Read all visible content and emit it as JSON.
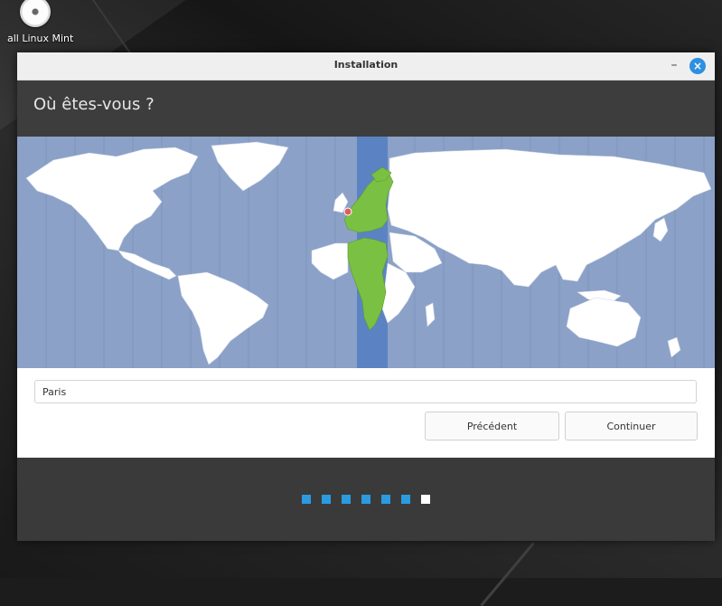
{
  "desktop": {
    "icon_label": "all Linux Mint",
    "icon_name": "disc-icon"
  },
  "window": {
    "title": "Installation",
    "minimize_label": "–",
    "close_label": "×"
  },
  "page": {
    "heading": "Où êtes-vous ?"
  },
  "map": {
    "selected_city": "Paris",
    "highlight_color": "#7ac143",
    "ocean_color": "#8ba1c7",
    "timezone_band_color": "#5b83c3",
    "marker_color": "#e05d5d"
  },
  "timezone_field": {
    "value": "Paris"
  },
  "buttons": {
    "previous": "Précédent",
    "continue": "Continuer"
  },
  "progress": {
    "total_steps": 7,
    "current_step": 7,
    "step_color": "#2b9be0",
    "current_color": "#ffffff"
  }
}
